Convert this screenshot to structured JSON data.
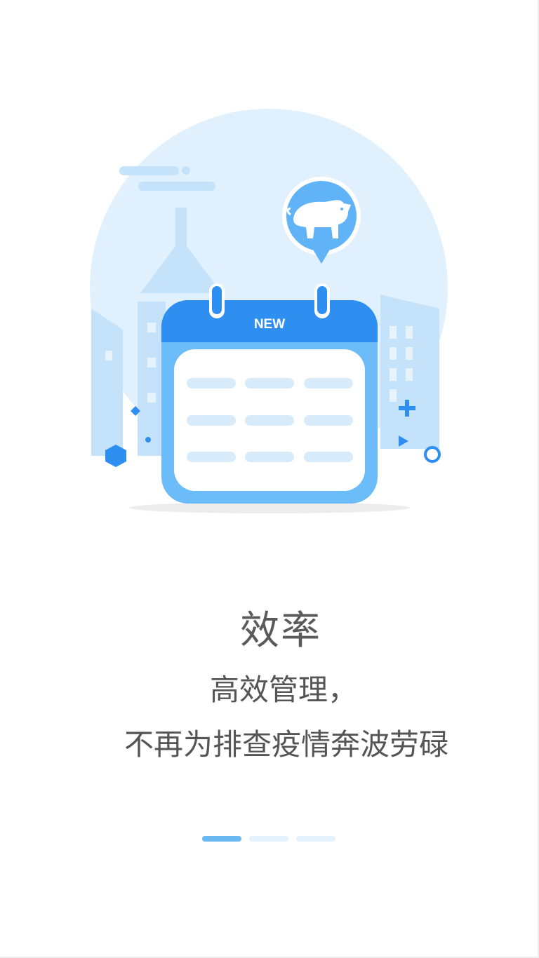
{
  "badge": {
    "calendar_label": "NEW"
  },
  "content": {
    "title": "效率",
    "line1": "高效管理，",
    "line2": "不再为排查疫情奔波劳碌"
  },
  "pager": {
    "total": 3,
    "active_index": 0
  },
  "colors": {
    "primary": "#2f8ff0",
    "light_blue": "#6cbcf9",
    "pale_blue": "#e0f1fd",
    "text": "#555555"
  },
  "icons": [
    "pig-icon",
    "calendar-icon",
    "plus-icon",
    "play-icon",
    "circle-icon",
    "hexagon-icon",
    "diamond-icon"
  ]
}
